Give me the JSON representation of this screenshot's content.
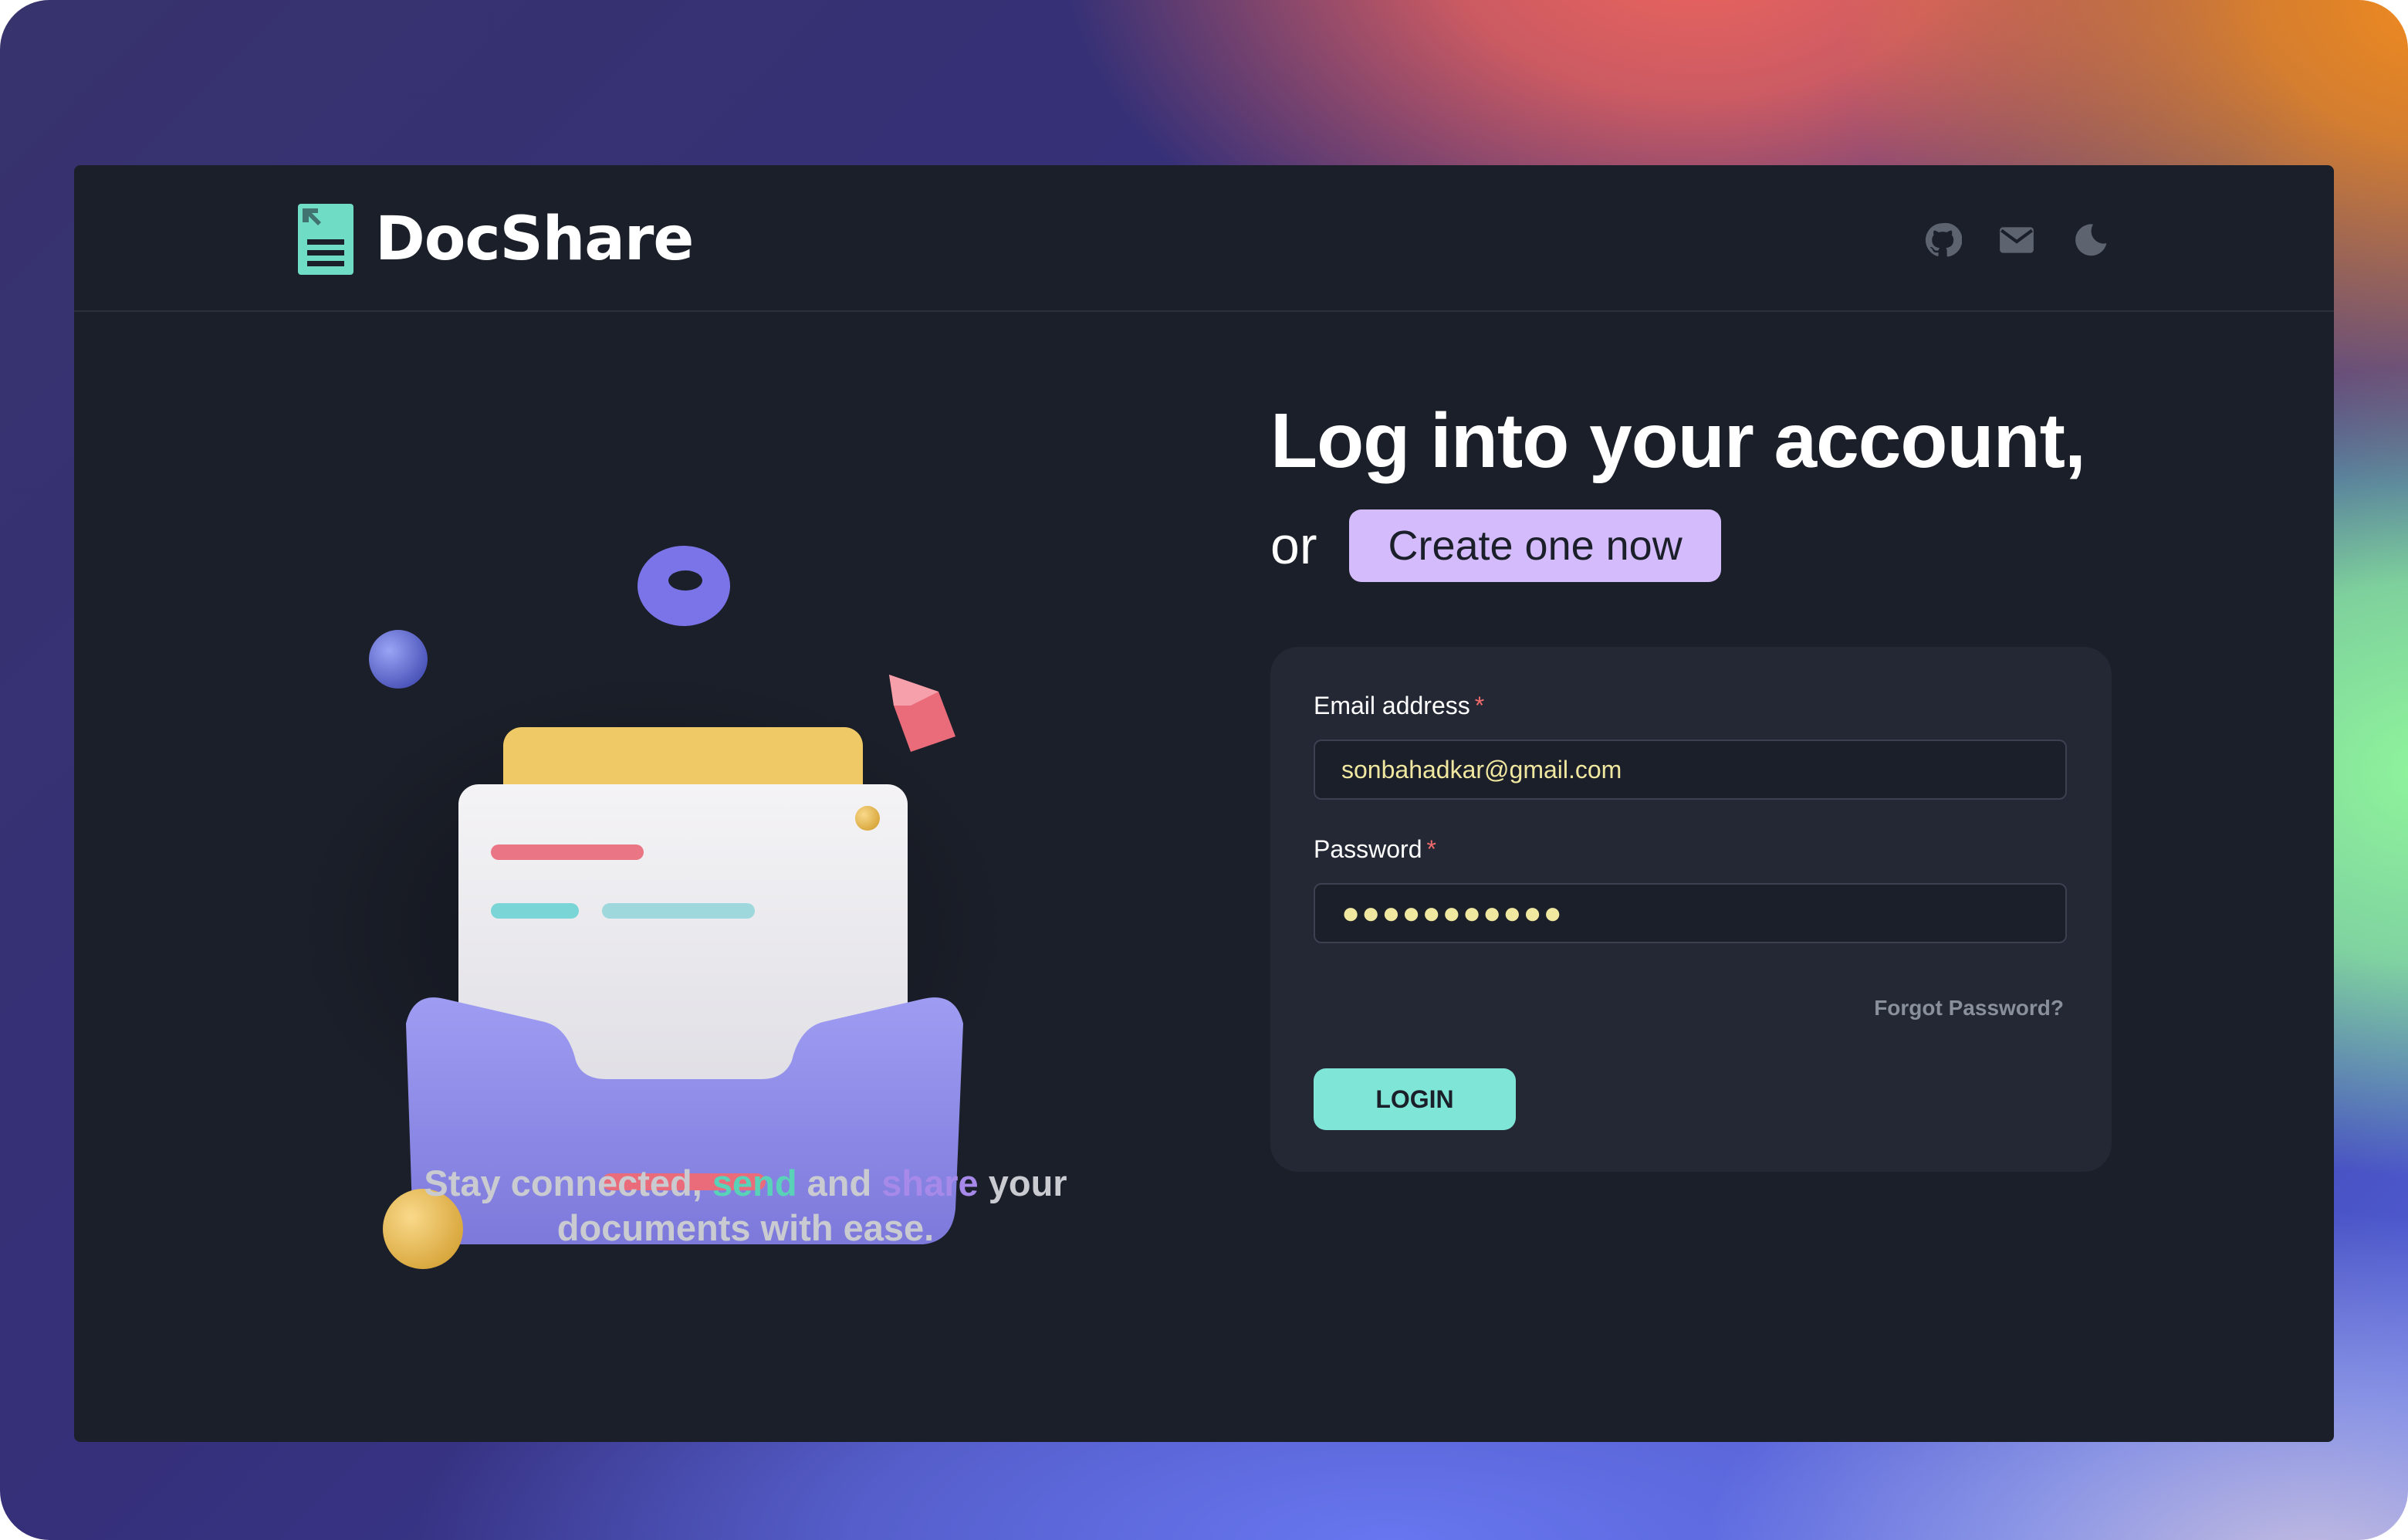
{
  "brand": {
    "name": "DocShare"
  },
  "header": {
    "icons": [
      "github-icon",
      "mail-icon",
      "moon-icon"
    ]
  },
  "hero": {
    "tagline_part1": "Stay connected, ",
    "tagline_send": "send",
    "tagline_part2": " and ",
    "tagline_share": "share",
    "tagline_part3": " your",
    "tagline_line2": "documents with ease."
  },
  "login": {
    "heading": "Log into your account,",
    "or_text": "or",
    "create_label": "Create one now",
    "email_label": "Email address",
    "email_value": "sonbahadkar@gmail.com",
    "password_label": "Password",
    "password_value": "●●●●●●●●●●●",
    "required_marker": "*",
    "forgot_label": "Forgot Password?",
    "login_label": "LOGIN"
  },
  "colors": {
    "accent_teal": "#7fe5d6",
    "accent_purple": "#d4bcfc",
    "app_bg": "#1b1f29",
    "card_bg": "#232834",
    "required": "#ef6b6b"
  }
}
